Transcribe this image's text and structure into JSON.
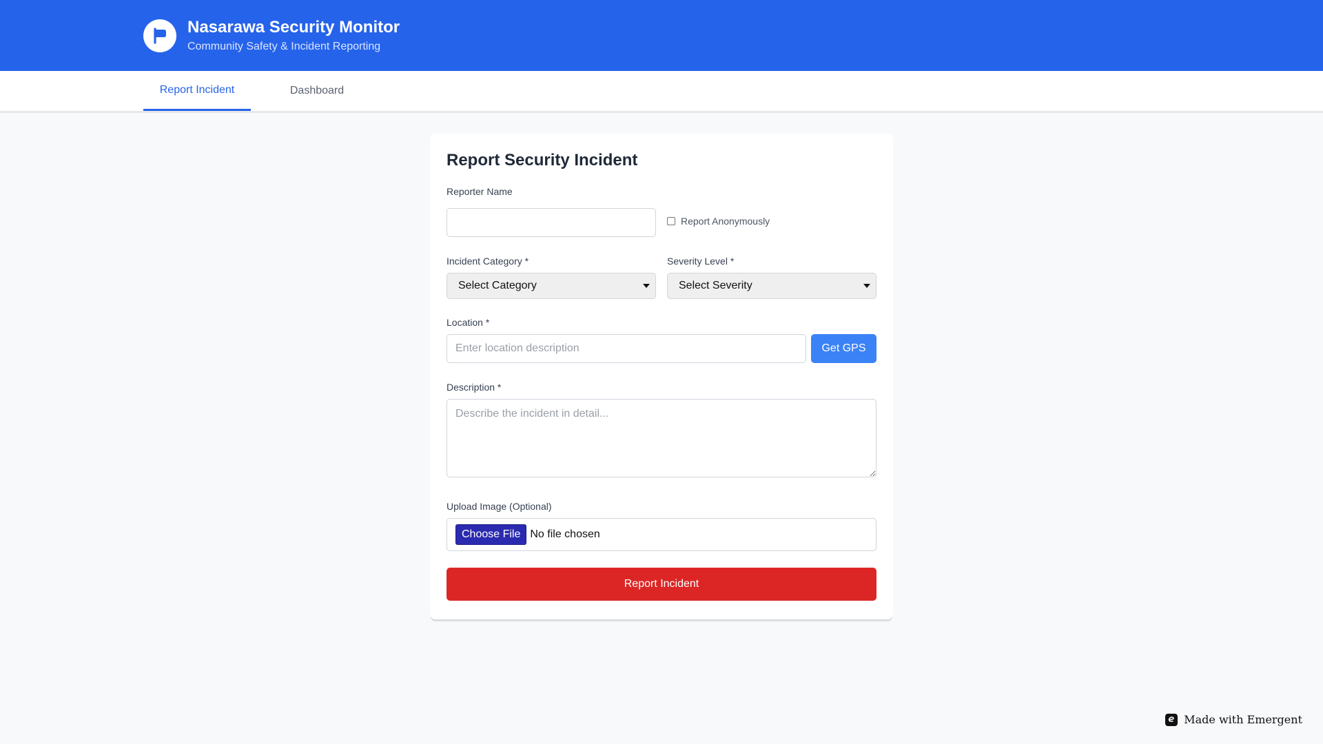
{
  "header": {
    "title": "Nasarawa Security Monitor",
    "subtitle": "Community Safety & Incident Reporting",
    "logo_icon": "flag-icon",
    "background": "#2563eb"
  },
  "nav": {
    "tabs": [
      {
        "label": "Report Incident",
        "active": true
      },
      {
        "label": "Dashboard",
        "active": false
      }
    ]
  },
  "form": {
    "title": "Report Security Incident",
    "reporter_name": {
      "label": "Reporter Name",
      "value": "",
      "placeholder": ""
    },
    "anonymous": {
      "label": "Report Anonymously",
      "checked": false
    },
    "category": {
      "label": "Incident Category *",
      "selected": "Select Category"
    },
    "severity": {
      "label": "Severity Level *",
      "selected": "Select Severity"
    },
    "location": {
      "label": "Location *",
      "placeholder": "Enter location description",
      "value": "",
      "gps_button": "Get GPS"
    },
    "description": {
      "label": "Description *",
      "placeholder": "Describe the incident in detail...",
      "value": ""
    },
    "upload": {
      "label": "Upload Image (Optional)",
      "button": "Choose File",
      "status": "No file chosen"
    },
    "submit": "Report Incident",
    "colors": {
      "gps": "#3b82f6",
      "submit": "#dc2626"
    }
  },
  "footer": {
    "badge": "Made with Emergent",
    "badge_icon": "emergent-logo-icon"
  }
}
